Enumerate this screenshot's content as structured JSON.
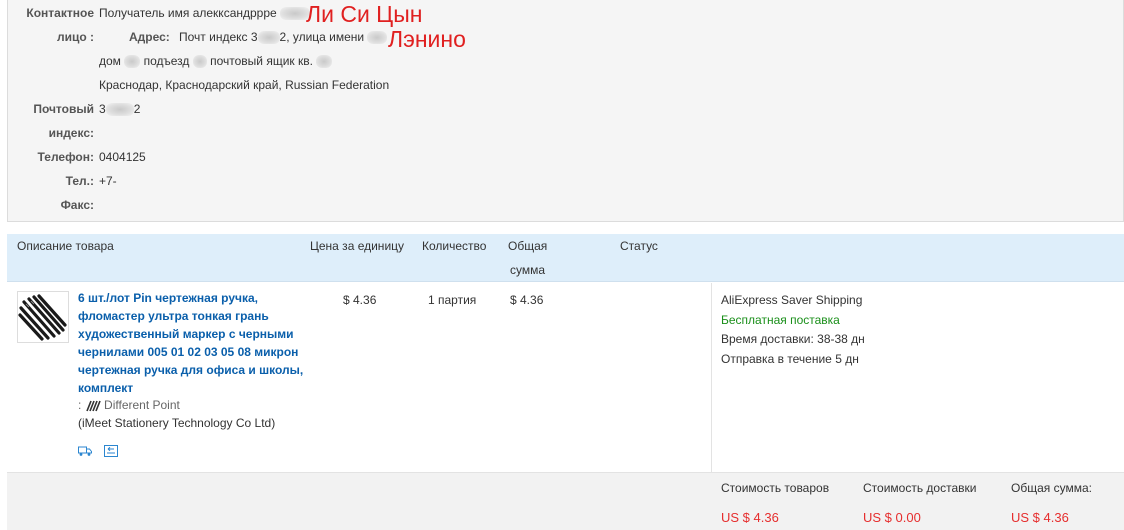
{
  "contact": {
    "label_contact_line1": "Контактное",
    "label_contact_line2": "лицо :",
    "recipient_text": "Получатель имя алекксандрppe",
    "handwritten_name": "Ли Си Цын",
    "address_label": "Адрес:",
    "address_line1_start": "Почт индекс 3",
    "address_line1_mid": "2, улица имени",
    "handwritten_street": "Лэнино",
    "address_line2_a": "дом",
    "address_line2_b": "подъезд",
    "address_line2_c": "почтовый ящик кв.",
    "address_line3": "Краснодар, Краснодарский край, Russian Federation",
    "label_postal_line1": "Почтовый",
    "label_postal_line2": "индекс:",
    "postal_start": "3",
    "postal_end": "2",
    "label_phone": "Телефон:",
    "phone_value": "0404125",
    "label_tel": "Тел.:",
    "tel_value": "+7-",
    "label_fax": "Факс:"
  },
  "table": {
    "headers": {
      "description": "Описание товара",
      "unit_price": "Цена за единицу",
      "quantity": "Количество",
      "total_line1": "Общая",
      "total_line2": "сумма",
      "status": "Статус"
    },
    "item": {
      "title": "6 шт./лот Pin чертежная ручка, фломастер ультра тонкая грань художественный маркер с черными чернилами 005 01 02 03 05 08 микрон чертежная ручка для офиса и школы, комплект",
      "attr_prefix": ":",
      "attr_value": "Different Point",
      "seller": "(iMeet Stationery Technology Co Ltd)",
      "unit_price": "$ 4.36",
      "quantity": "1 партия",
      "total": "$ 4.36",
      "icons": [
        "delivery-truck-icon",
        "return-arrow-icon"
      ]
    },
    "shipping": {
      "method": "AliExpress Saver Shipping",
      "free": "Бесплатная поставка",
      "time_label": "Время доставки:",
      "time_value": "38-38 дн",
      "dispatch_label": "Отправка в течение",
      "dispatch_value": "5 дн"
    }
  },
  "footer": {
    "goods_label": "Стоимость товаров",
    "shipping_label": "Стоимость доставки",
    "total_label": "Общая сумма:",
    "goods_value": "US $ 4.36",
    "shipping_value": "US $ 0.00",
    "total_value": "US $ 4.36"
  },
  "colors": {
    "link_blue": "#0a5fab",
    "header_bg": "#deeefa",
    "free_green": "#1a8f1a",
    "price_red": "#e62e2e",
    "note_red": "#e02020"
  }
}
